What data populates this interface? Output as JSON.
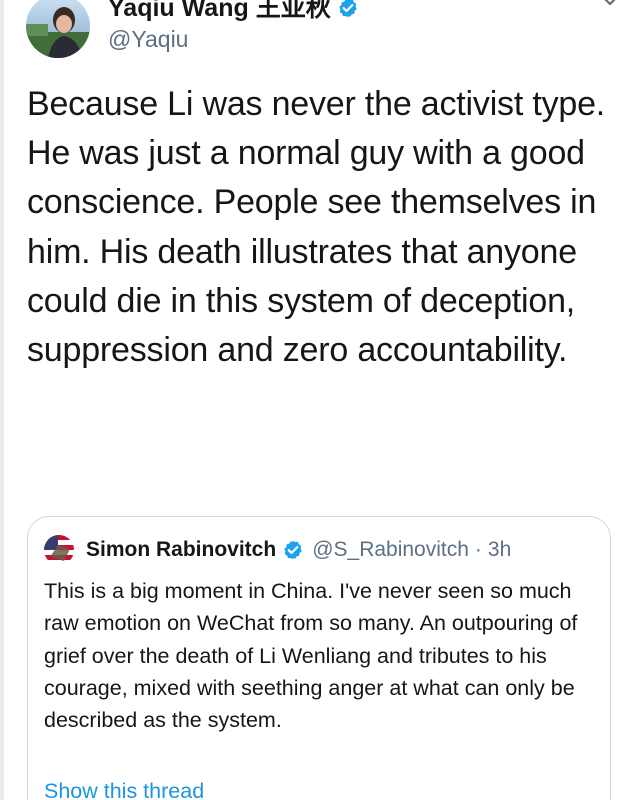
{
  "tweet": {
    "author": {
      "name": "Yaqiu Wang 王亚秋",
      "handle": "@Yaqiu",
      "verified": true
    },
    "text": "Because Li was never the activist type. He was just a normal guy with a good conscience. People see themselves in him. His death illustrates that anyone could die in this system of deception, suppression and zero accountability.",
    "quoted": {
      "author": {
        "name": "Simon Rabinovitch",
        "handle": "@S_Rabinovitch",
        "separator": "·",
        "time": "3h",
        "verified": true
      },
      "text": "This is a big moment in China. I've never seen so much raw emotion on WeChat from so many. An outpouring of grief over the death of Li Wenliang and tributes to his courage, mixed with seething anger at what can only be described as the system.",
      "show_thread_label": "Show this thread"
    }
  },
  "icons": {
    "verified": "verified-badge-icon",
    "more": "chevron-down-icon"
  },
  "colors": {
    "text": "#14171a",
    "secondary": "#5b7083",
    "link": "#1b95e0",
    "verified": "#1da1f2",
    "border": "#cfd9de"
  }
}
